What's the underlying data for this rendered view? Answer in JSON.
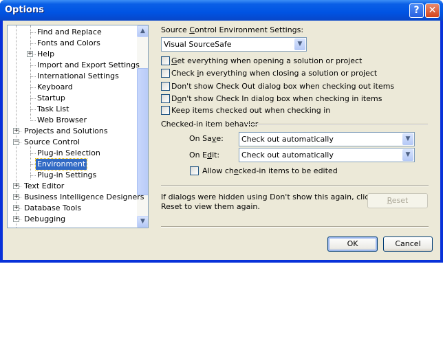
{
  "window": {
    "title": "Options",
    "help_glyph": "?",
    "close_glyph": "✕"
  },
  "tree": {
    "items": [
      {
        "label": "Find and Replace",
        "level": 1
      },
      {
        "label": "Fonts and Colors",
        "level": 1
      },
      {
        "label": "Help",
        "level": 1,
        "expander": "+"
      },
      {
        "label": "Import and Export Settings",
        "level": 1
      },
      {
        "label": "International Settings",
        "level": 1
      },
      {
        "label": "Keyboard",
        "level": 1
      },
      {
        "label": "Startup",
        "level": 1
      },
      {
        "label": "Task List",
        "level": 1
      },
      {
        "label": "Web Browser",
        "level": 1
      },
      {
        "label": "Projects and Solutions",
        "level": 0,
        "expander": "+"
      },
      {
        "label": "Source Control",
        "level": 0,
        "expander": "−"
      },
      {
        "label": "Plug-in Selection",
        "level": 1
      },
      {
        "label": "Environment",
        "level": 1,
        "selected": true
      },
      {
        "label": "Plug-in Settings",
        "level": 1
      },
      {
        "label": "Text Editor",
        "level": 0,
        "expander": "+"
      },
      {
        "label": "Business Intelligence Designers",
        "level": 0,
        "expander": "+"
      },
      {
        "label": "Database Tools",
        "level": 0,
        "expander": "+"
      },
      {
        "label": "Debugging",
        "level": 0,
        "expander": "+"
      }
    ],
    "scroll_up": "▲",
    "scroll_down": "▼"
  },
  "settings": {
    "env_label": {
      "text": "Source Control Environment Settings:",
      "key": "C"
    },
    "env_value": "Visual SourceSafe",
    "checkboxes": [
      {
        "text": "Get everything when opening a solution or project",
        "key": "G",
        "checked": false
      },
      {
        "text": "Check in everything when closing a solution or project",
        "key": "i",
        "checked": false
      },
      {
        "text": "Don't show Check Out dialog box when checking out items",
        "key": "",
        "checked": false
      },
      {
        "text": "Don't show Check In dialog box when checking in items",
        "key": "o",
        "checked": false
      },
      {
        "text": "Keep items checked out when checking in",
        "key": "",
        "checked": false
      }
    ],
    "group_label": "Checked-in item behavior",
    "on_save": {
      "text": "On Save:",
      "key": "v",
      "value": "Check out automatically"
    },
    "on_edit": {
      "text": "On Edit:",
      "key": "d",
      "value": "Check out automatically"
    },
    "allow_edit": {
      "text": "Allow checked-in items to be edited",
      "key": "e",
      "checked": false
    },
    "reset_note": [
      "If dialogs were hidden using Don't show this again, click",
      "Reset to view them again."
    ],
    "reset": {
      "text": "Reset",
      "key": "R",
      "enabled": false
    }
  },
  "buttons": {
    "ok": "OK",
    "cancel": "Cancel"
  },
  "colors": {
    "title_bar": "#0054e3",
    "selection": "#316ac5",
    "face": "#ece9d8"
  }
}
